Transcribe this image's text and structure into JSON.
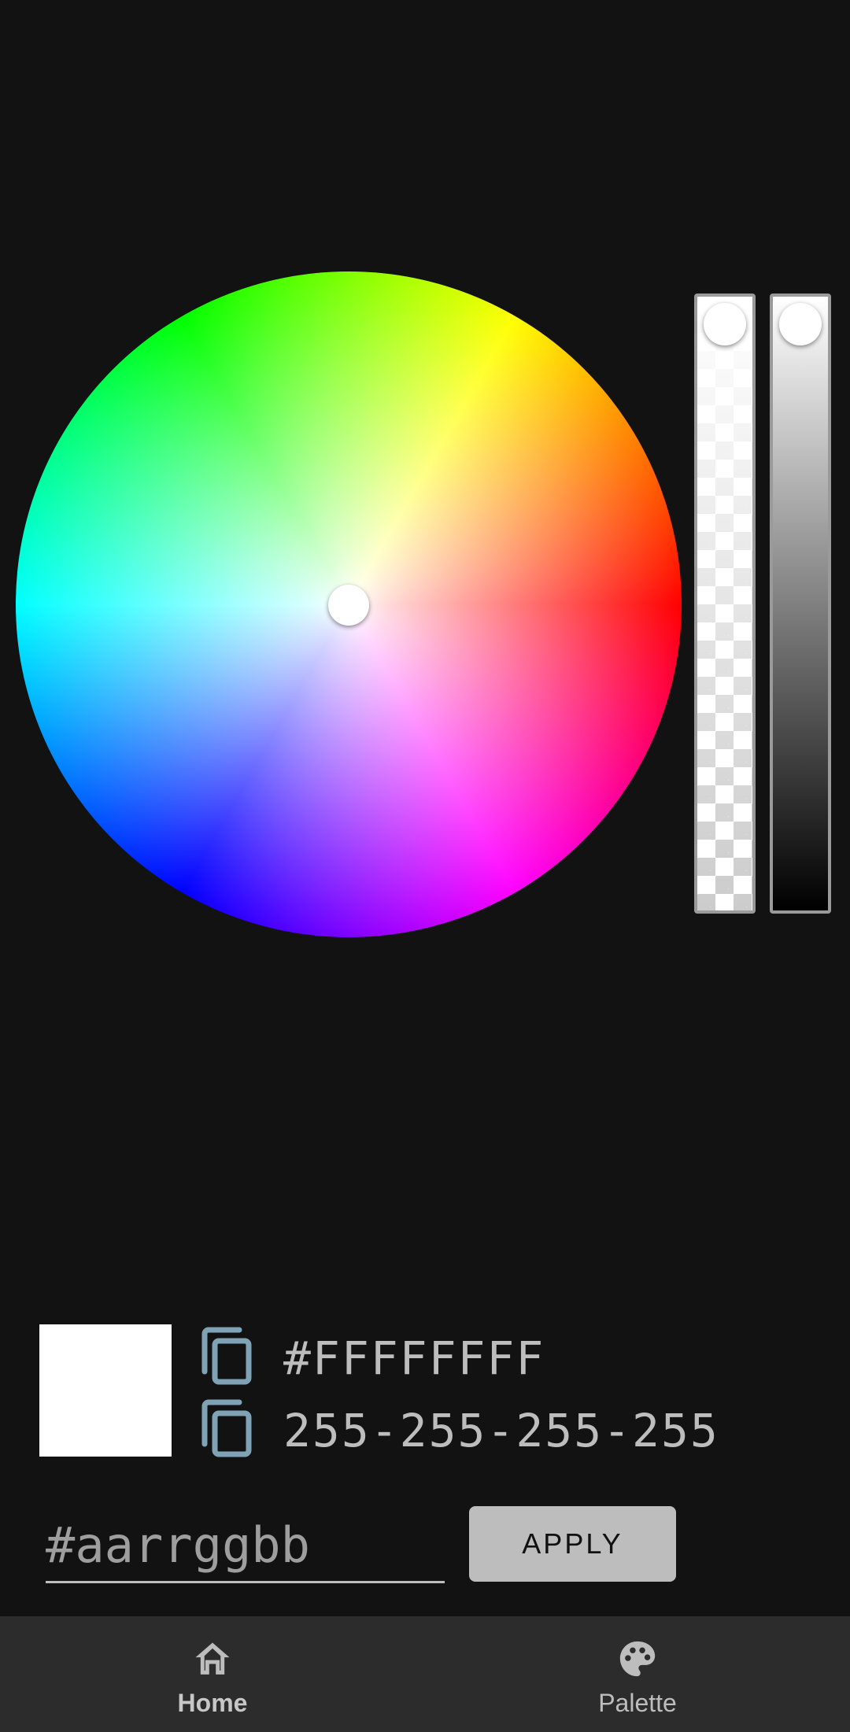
{
  "color_picker": {
    "selected_hex": "#FFFFFFFF",
    "selected_rgb": "255-255-255-255",
    "preview_color": "#FFFFFF"
  },
  "input": {
    "placeholder": "#aarrggbb"
  },
  "buttons": {
    "apply_label": "APPLY"
  },
  "bottom_nav": {
    "items": [
      {
        "label": "Home",
        "icon": "home-icon",
        "active": true
      },
      {
        "label": "Palette",
        "icon": "palette-icon",
        "active": false
      }
    ]
  },
  "colors": {
    "background": "#121212",
    "nav_background": "#2C2C2C",
    "copy_icon": "#7FA3B5",
    "text": "#BDBDBD"
  }
}
